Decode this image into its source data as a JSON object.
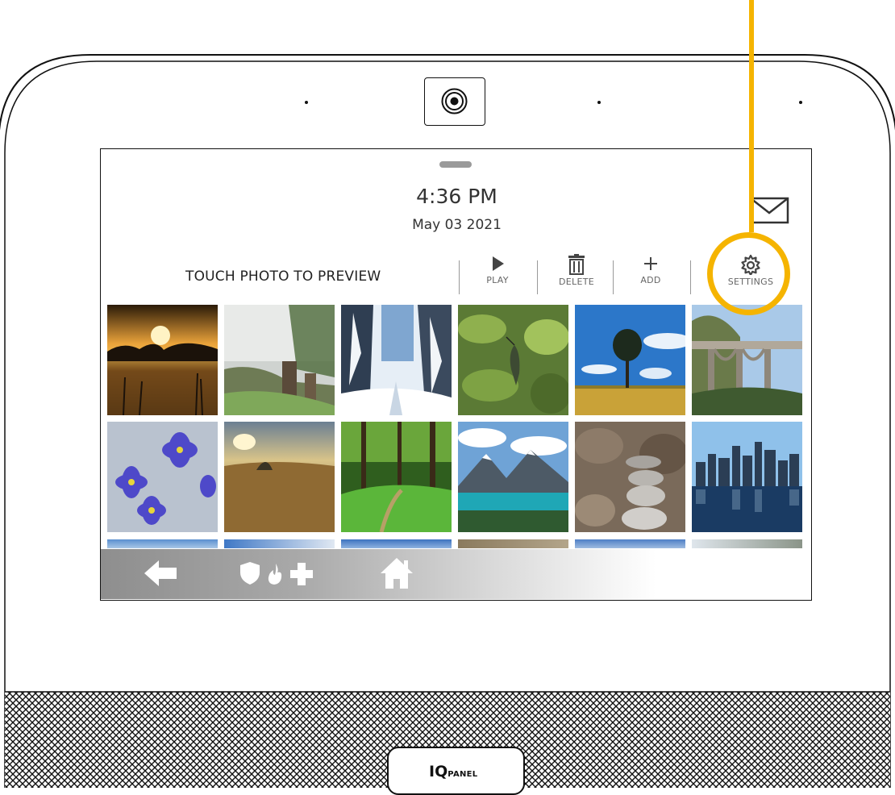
{
  "status": {
    "time": "4:36 PM",
    "date": "May 03 2021"
  },
  "toolbar": {
    "hint": "TOUCH PHOTO TO PREVIEW",
    "play_label": "PLAY",
    "delete_label": "DELETE",
    "add_label": "ADD",
    "settings_label": "SETTINGS"
  },
  "logo": {
    "brand": "IQ",
    "product": "PANEL"
  },
  "photos": [
    "sunset-lake",
    "misty-stumps",
    "snowy-forest",
    "hummingbird",
    "tree-field",
    "coastal-bridge",
    "blue-flowers",
    "golden-meadow",
    "green-forest-path",
    "mountain-lake",
    "stacked-stones",
    "city-skyline"
  ],
  "colors": {
    "callout": "#f5b400",
    "nav_gradient_start": "#8e8e8e",
    "bezel": "#111111"
  },
  "icons": [
    "camera-icon",
    "mail-icon",
    "play-icon",
    "trash-icon",
    "plus-icon",
    "gear-icon",
    "back-arrow-icon",
    "shield-icon",
    "fire-icon",
    "medical-cross-icon",
    "home-icon"
  ]
}
